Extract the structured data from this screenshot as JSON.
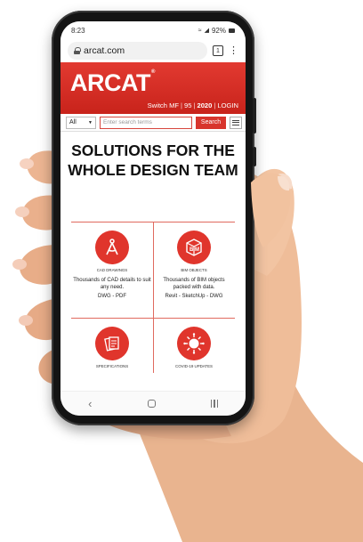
{
  "status_bar": {
    "time": "8:23",
    "battery": "92%"
  },
  "browser": {
    "url": "arcat.com",
    "tab_count": "1"
  },
  "header": {
    "logo": "ARCAT",
    "switch_label": "Switch",
    "mf_label": "MF",
    "edition_95": "95",
    "edition_2020": "2020",
    "login_label": "LOGIN",
    "separator": "|"
  },
  "search": {
    "category": "All",
    "placeholder": "Enter search terms",
    "button_label": "Search"
  },
  "headline": "SOLUTIONS FOR THE WHOLE DESIGN TEAM",
  "cards": [
    {
      "title": "CAD DRAWINGS",
      "description": "Thousands of CAD details to suit any need.",
      "formats": "DWG - PDF",
      "icon": "compass-icon"
    },
    {
      "title": "BIM OBJECTS",
      "description": "Thousands of BIM objects packed with data.",
      "formats": "Revit - SketchUp - DWG",
      "icon": "bim-cube-icon"
    },
    {
      "title": "SPECIFICATIONS",
      "description": "",
      "formats": "",
      "icon": "documents-icon"
    },
    {
      "title": "COVID-19 UPDATES",
      "description": "",
      "formats": "",
      "icon": "virus-icon"
    }
  ],
  "colors": {
    "brand_red": "#d8352d",
    "divider": "#e06a5f"
  }
}
